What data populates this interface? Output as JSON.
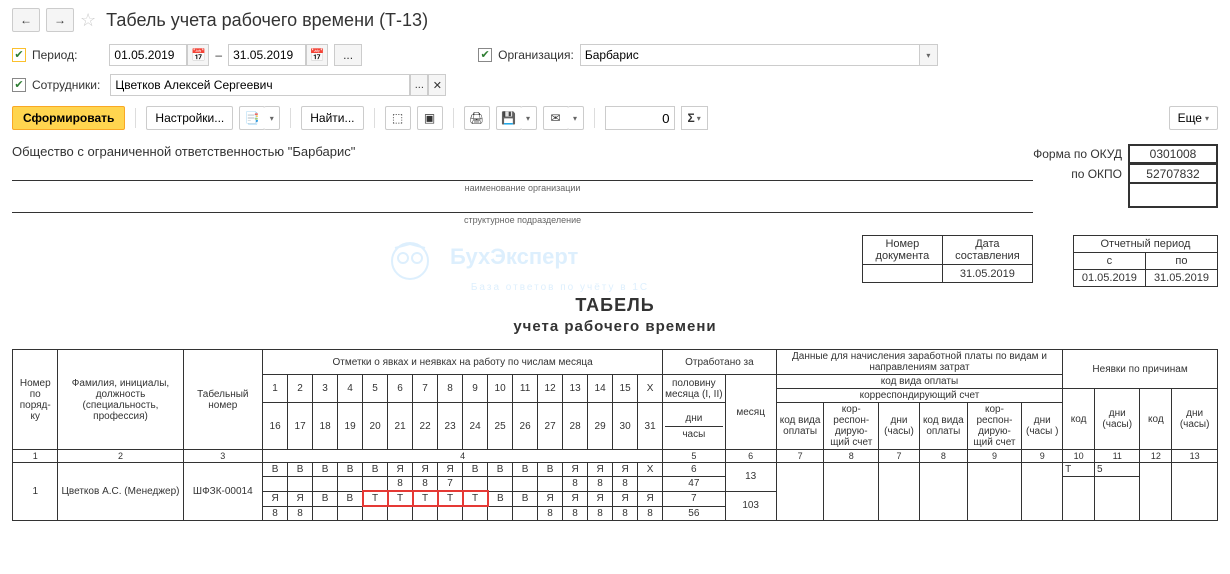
{
  "header": {
    "title": "Табель учета рабочего времени (Т-13)"
  },
  "filters": {
    "period_label": "Период:",
    "date_from": "01.05.2019",
    "date_sep": "–",
    "date_to": "31.05.2019",
    "org_label": "Организация:",
    "org_value": "Барбарис",
    "emp_label": "Сотрудники:",
    "emp_value": "Цветков Алексей Сергеевич"
  },
  "toolbar": {
    "generate": "Сформировать",
    "settings": "Настройки...",
    "find": "Найти...",
    "num_value": "0",
    "more": "Еще"
  },
  "report": {
    "org_name": "Общество с ограниченной ответственностью \"Барбарис\"",
    "org_caption": "наименование организации",
    "struct_caption": "структурное подразделение",
    "okud_label": "Форма по ОКУД",
    "okud_val": "0301008",
    "okpo_label": "по ОКПО",
    "okpo_val": "52707832",
    "doc_num_label": "Номер документа",
    "doc_num_val": "",
    "doc_date_label": "Дата составления",
    "doc_date_val": "31.05.2019",
    "period_label": "Отчетный период",
    "period_from_label": "с",
    "period_to_label": "по",
    "period_from": "01.05.2019",
    "period_to": "31.05.2019",
    "title": "ТАБЕЛЬ",
    "subtitle": "учета  рабочего времени",
    "watermark_title": "БухЭксперт",
    "watermark_sub": "База ответов по учёту в 1С"
  },
  "table": {
    "h_num": "Номер по поряд-ку",
    "h_fio": "Фамилия, инициалы, должность (специальность, профессия)",
    "h_tab": "Табельный номер",
    "h_marks": "Отметки о явках и неявках на работу по числам месяца",
    "h_worked": "Отработано за",
    "h_half": "половину месяца (I, II)",
    "h_month": "месяц",
    "h_days": "дни",
    "h_hours": "часы",
    "h_payroll": "Данные для начисления заработной платы по видам и направлениям затрат",
    "h_code": "код вида оплаты",
    "h_corr": "корреспондирующий счет",
    "h_paycode": "код вида оплаты",
    "h_corracc": "кор-респон-дирую-щий счет",
    "h_dayshrs": "дни (часы)",
    "h_dayshrs2": "дни (часы )",
    "h_absence": "Неявки по причинам",
    "h_abs_code": "код",
    "h_abs_dh": "дни (часы)",
    "days1": [
      "1",
      "2",
      "3",
      "4",
      "5",
      "6",
      "7",
      "8",
      "9",
      "10",
      "11",
      "12",
      "13",
      "14",
      "15",
      "X"
    ],
    "days2": [
      "16",
      "17",
      "18",
      "19",
      "20",
      "21",
      "22",
      "23",
      "24",
      "25",
      "26",
      "27",
      "28",
      "29",
      "30",
      "31"
    ],
    "col_nums": [
      "1",
      "2",
      "3",
      "4",
      "5",
      "6",
      "7",
      "8",
      "7",
      "8",
      "9",
      "9",
      "10",
      "11",
      "12",
      "13"
    ],
    "rows": [
      {
        "num": "1",
        "fio": "Цветков А.С. (Менеджер)",
        "tabnum": "ШФЗК-00014",
        "line1": [
          "В",
          "В",
          "В",
          "В",
          "В",
          "Я",
          "Я",
          "Я",
          "В",
          "В",
          "В",
          "В",
          "Я",
          "Я",
          "Я",
          "X"
        ],
        "line2": [
          "",
          "",
          "",
          "",
          "",
          "8",
          "8",
          "7",
          "",
          "",
          "",
          "",
          "8",
          "8",
          "8",
          ""
        ],
        "line3": [
          "Я",
          "Я",
          "В",
          "В",
          "Т",
          "Т",
          "Т",
          "Т",
          "Т",
          "В",
          "В",
          "Я",
          "Я",
          "Я",
          "Я",
          "Я"
        ],
        "line4": [
          "8",
          "8",
          "",
          "",
          "",
          "",
          "",
          "",
          "",
          "",
          "",
          "8",
          "8",
          "8",
          "8",
          "8"
        ],
        "half1": "6",
        "half1h": "47",
        "half2": "7",
        "half2h": "56",
        "month": "13",
        "monthh": "103",
        "abs_code": "Т",
        "abs_dh": "5"
      }
    ]
  }
}
